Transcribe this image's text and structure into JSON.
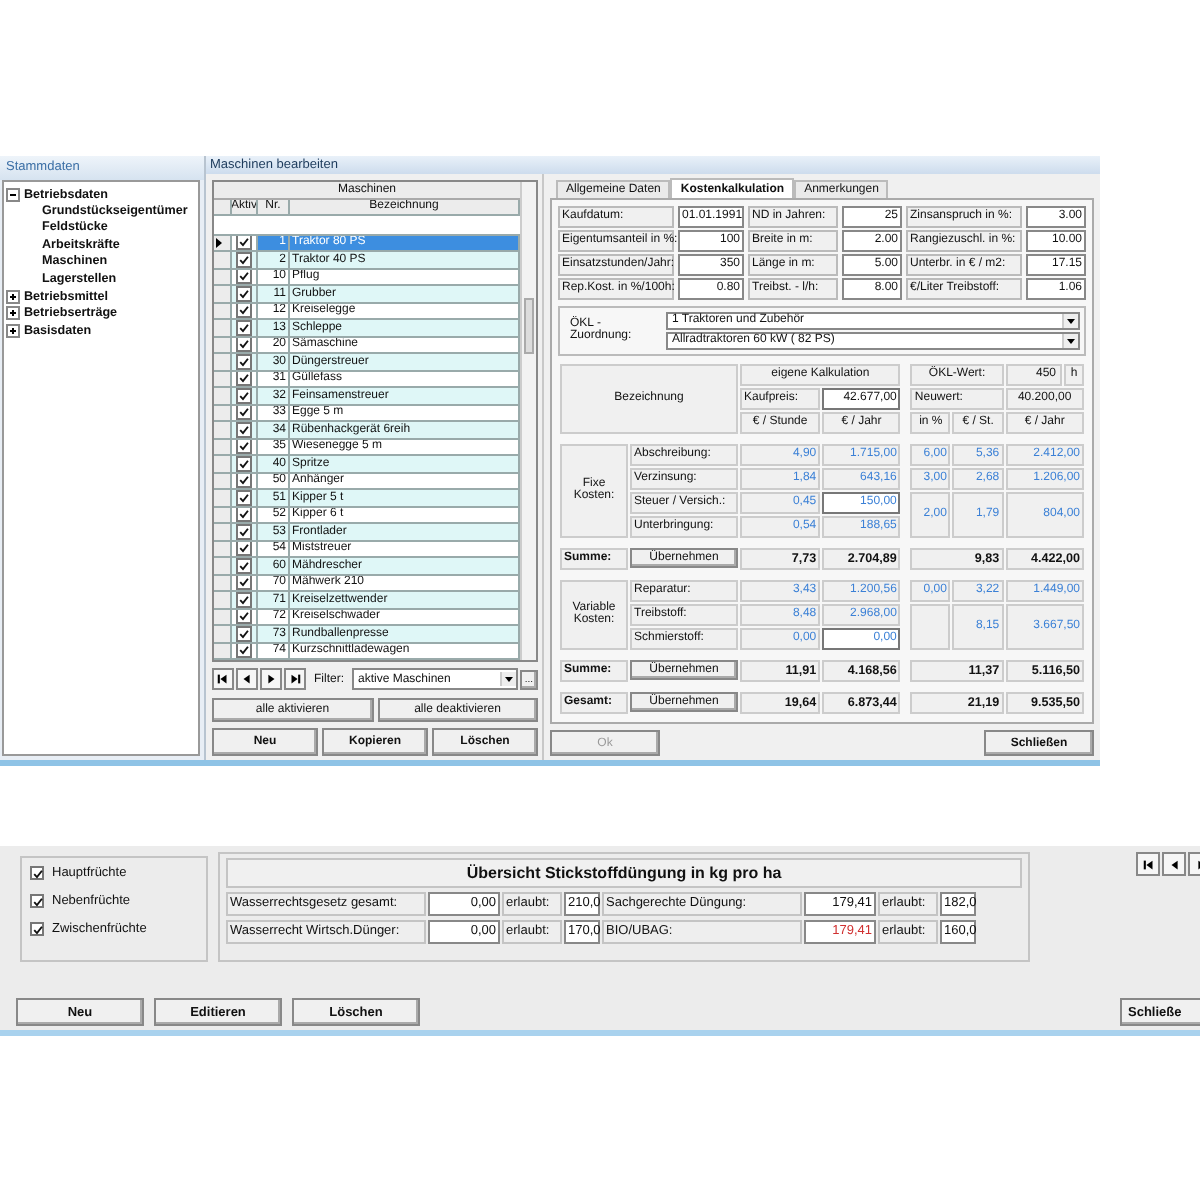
{
  "sidebar": {
    "title": "Stammdaten",
    "tree": [
      {
        "label": "Betriebsdaten",
        "expanded": true,
        "children": [
          {
            "label": "Grundstückseigentümer"
          },
          {
            "label": "Feldstücke"
          },
          {
            "label": "Arbeitskräfte"
          },
          {
            "label": "Maschinen"
          },
          {
            "label": "Lagerstellen"
          }
        ]
      },
      {
        "label": "Betriebsmittel",
        "expanded": false
      },
      {
        "label": "Betriebserträge",
        "expanded": false
      },
      {
        "label": "Basisdaten",
        "expanded": false
      }
    ]
  },
  "window": {
    "title": "Maschinen bearbeiten"
  },
  "machines": {
    "group_header": "Maschinen",
    "columns": [
      "Aktiv",
      "Nr.",
      "Bezeichnung"
    ],
    "rows": [
      {
        "active": true,
        "nr": "1",
        "name": "Traktor 80 PS",
        "selected": true
      },
      {
        "active": true,
        "nr": "2",
        "name": "Traktor 40 PS",
        "selected": false
      },
      {
        "active": true,
        "nr": "10",
        "name": "Pflug",
        "selected": false
      },
      {
        "active": true,
        "nr": "11",
        "name": "Grubber",
        "selected": false
      },
      {
        "active": true,
        "nr": "12",
        "name": "Kreiselegge",
        "selected": false
      },
      {
        "active": true,
        "nr": "13",
        "name": "Schleppe",
        "selected": false
      },
      {
        "active": true,
        "nr": "20",
        "name": "Sämaschine",
        "selected": false
      },
      {
        "active": true,
        "nr": "30",
        "name": "Düngerstreuer",
        "selected": false
      },
      {
        "active": true,
        "nr": "31",
        "name": "Güllefass",
        "selected": false
      },
      {
        "active": true,
        "nr": "32",
        "name": "Feinsamenstreuer",
        "selected": false
      },
      {
        "active": true,
        "nr": "33",
        "name": "Egge 5 m",
        "selected": false
      },
      {
        "active": true,
        "nr": "34",
        "name": "Rübenhackgerät 6reih",
        "selected": false
      },
      {
        "active": true,
        "nr": "35",
        "name": "Wiesenegge 5 m",
        "selected": false
      },
      {
        "active": true,
        "nr": "40",
        "name": "Spritze",
        "selected": false
      },
      {
        "active": true,
        "nr": "50",
        "name": "Anhänger",
        "selected": false
      },
      {
        "active": true,
        "nr": "51",
        "name": "Kipper 5 t",
        "selected": false
      },
      {
        "active": true,
        "nr": "52",
        "name": "Kipper 6 t",
        "selected": false
      },
      {
        "active": true,
        "nr": "53",
        "name": "Frontlader",
        "selected": false
      },
      {
        "active": true,
        "nr": "54",
        "name": "Miststreuer",
        "selected": false
      },
      {
        "active": true,
        "nr": "60",
        "name": "Mähdrescher",
        "selected": false
      },
      {
        "active": true,
        "nr": "70",
        "name": "Mähwerk 210",
        "selected": false
      },
      {
        "active": true,
        "nr": "71",
        "name": "Kreiselzettwender",
        "selected": false
      },
      {
        "active": true,
        "nr": "72",
        "name": "Kreiselschwader",
        "selected": false
      },
      {
        "active": true,
        "nr": "73",
        "name": "Rundballenpresse",
        "selected": false
      },
      {
        "active": true,
        "nr": "74",
        "name": "Kurzschnittladewagen",
        "selected": false
      }
    ],
    "filter_label": "Filter:",
    "filter_value": "aktive Maschinen",
    "browse_button": "...",
    "bulk_buttons": [
      "alle aktivieren",
      "alle deaktivieren"
    ],
    "actions": [
      "Neu",
      "Kopieren",
      "Löschen"
    ]
  },
  "tabs": [
    {
      "label": "Allgemeine Daten",
      "selected": false
    },
    {
      "label": "Kostenkalkulation",
      "selected": true
    },
    {
      "label": "Anmerkungen",
      "selected": false
    }
  ],
  "form": [
    [
      {
        "label": "Kaufdatum:",
        "value": "01.01.1991"
      },
      {
        "label": "ND in Jahren:",
        "value": "25"
      },
      {
        "label": "Zinsanspruch in %:",
        "value": "3.00"
      }
    ],
    [
      {
        "label": "Eigentumsanteil in %:",
        "value": "100"
      },
      {
        "label": "Breite in m:",
        "value": "2.00"
      },
      {
        "label": "Rangiezuschl. in %:",
        "value": "10.00"
      }
    ],
    [
      {
        "label": "Einsatzstunden/Jahr:",
        "value": "350"
      },
      {
        "label": "Länge in m:",
        "value": "5.00"
      },
      {
        "label": "Unterbr. in € / m2:",
        "value": "17.15"
      }
    ],
    [
      {
        "label": "Rep.Kost. in %/100h:",
        "value": "0.80"
      },
      {
        "label": "Treibst. - l/h:",
        "value": "8.00"
      },
      {
        "label": "€/Liter Treibstoff:",
        "value": "1.06"
      }
    ]
  ],
  "oekl": {
    "label": "ÖKL - Zuordnung:",
    "values": [
      "1 Traktoren und Zubehör",
      "Allradtraktoren 60 kW ( 82 PS)"
    ]
  },
  "cost_table": {
    "heading": "Bezeichnung",
    "own_label": "eigene Kalkulation",
    "price_label": "Kaufpreis:",
    "price": "42.677,00",
    "oekl_label": "ÖKL-Wert:",
    "oekl_value": "450",
    "oekl_unit": "h",
    "new_label": "Neuwert:",
    "new_value": "40.200,00",
    "columns": [
      "€ / Stunde",
      "€ / Jahr",
      "in %",
      "€ / St.",
      "€ / Jahr"
    ],
    "groups": [
      {
        "label": "Fixe Kosten:",
        "rows": [
          {
            "label": "Abschreibung:",
            "per_hour": "4,90",
            "per_year": "1.715,00",
            "per_year_editable": false,
            "oekl": {
              "percent": "6,00",
              "per_hour": "5,36",
              "per_year": "2.412,00"
            },
            "oekl_merged": false
          },
          {
            "label": "Verzinsung:",
            "per_hour": "1,84",
            "per_year": "643,16",
            "per_year_editable": false,
            "oekl": {
              "percent": "3,00",
              "per_hour": "2,68",
              "per_year": "1.206,00"
            },
            "oekl_merged": false
          },
          {
            "label": "Steuer / Versich.:",
            "per_hour": "0,45",
            "per_year": "150,00",
            "per_year_editable": true,
            "oekl": {
              "percent": "2,00",
              "per_hour": "1,79",
              "per_year": "804,00"
            },
            "oekl_merged": true
          },
          {
            "label": "Unterbringung:",
            "per_hour": "0,54",
            "per_year": "188,65",
            "per_year_editable": false
          }
        ],
        "sum": {
          "label": "Summe:",
          "button": "Übernehmen",
          "values": [
            "7,73",
            "2.704,89",
            "9,83",
            "4.422,00"
          ]
        }
      },
      {
        "label": "Variable Kosten:",
        "rows": [
          {
            "label": "Reparatur:",
            "per_hour": "3,43",
            "per_year": "1.200,56",
            "per_year_editable": false,
            "oekl": {
              "percent": "0,00",
              "per_hour": "3,22",
              "per_year": "1.449,00"
            },
            "oekl_merged": false
          },
          {
            "label": "Treibstoff:",
            "per_hour": "8,48",
            "per_year": "2.968,00",
            "per_year_editable": false,
            "oekl": {
              "per_hour": "8,15",
              "per_year": "3.667,50"
            },
            "oekl_merged": true
          },
          {
            "label": "Schmierstoff:",
            "per_hour": "0,00",
            "per_year": "0,00",
            "per_year_editable": true
          }
        ],
        "sum": {
          "label": "Summe:",
          "button": "Übernehmen",
          "values": [
            "11,91",
            "4.168,56",
            "11,37",
            "5.116,50"
          ]
        }
      }
    ],
    "total": {
      "label": "Gesamt:",
      "button": "Übernehmen",
      "values": [
        "19,64",
        "6.873,44",
        "21,19",
        "9.535,50"
      ]
    }
  },
  "footer_buttons": [
    {
      "label": "Ok",
      "disabled": true
    },
    {
      "label": "Schließen",
      "disabled": false
    }
  ],
  "crops": [
    {
      "label": "Hauptfrüchte",
      "checked": true
    },
    {
      "label": "Nebenfrüchte",
      "checked": true
    },
    {
      "label": "Zwischenfrüchte",
      "checked": true
    }
  ],
  "overview": {
    "title": "Übersicht Stickstoffdüngung in kg pro ha",
    "rows": [
      [
        {
          "label": "Wasserrechtsgesetz gesamt:",
          "value": "0,00",
          "exceeded": false,
          "allowed_label": "erlaubt:",
          "allowed": "210,0"
        },
        {
          "label": "Sachgerechte Düngung:",
          "value": "179,41",
          "exceeded": false,
          "allowed_label": "erlaubt:",
          "allowed": "182,0"
        }
      ],
      [
        {
          "label": "Wasserrecht Wirtsch.Dünger:",
          "value": "0,00",
          "exceeded": false,
          "allowed_label": "erlaubt:",
          "allowed": "170,0"
        },
        {
          "label": "BIO/UBAG:",
          "value": "179,41",
          "exceeded": true,
          "allowed_label": "erlaubt:",
          "allowed": "160,0"
        }
      ]
    ]
  },
  "bottom_buttons": [
    "Neu",
    "Editieren",
    "Löschen"
  ],
  "bottom_close": "Schließe"
}
